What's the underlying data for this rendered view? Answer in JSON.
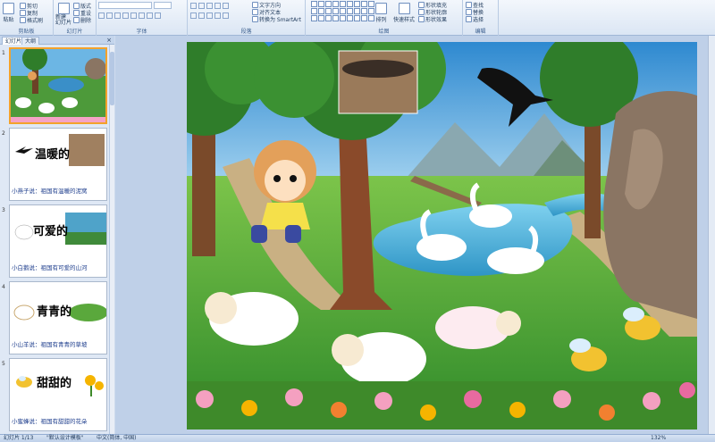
{
  "ribbon": {
    "clipboard": {
      "label": "剪贴板",
      "paste": "粘贴",
      "cut": "剪切",
      "copy": "复制",
      "format_painter": "格式刷"
    },
    "slides": {
      "label": "幻灯片",
      "new_slide": "新建\n幻灯片",
      "layout": "版式",
      "reset": "重设",
      "delete": "删除"
    },
    "font": {
      "label": "字体"
    },
    "paragraph": {
      "label": "段落",
      "text_direction": "文字方向",
      "align_text": "对齐文本",
      "smartart": "转换为 SmartArt"
    },
    "drawing": {
      "label": "绘图",
      "arrange": "排列",
      "quick_styles": "快速样式",
      "shape_fill": "形状填充",
      "shape_outline": "形状轮廓",
      "shape_effects": "形状效果"
    },
    "editing": {
      "label": "编辑",
      "find": "查找",
      "replace": "替换",
      "select": "选择"
    }
  },
  "left_panel": {
    "tabs": [
      "幻灯片",
      "大纲"
    ],
    "close": "×",
    "slides": [
      {
        "num": "1",
        "title": "",
        "caption": ""
      },
      {
        "num": "2",
        "title": "温暖的",
        "caption": "小燕子说：祖国有温暖的泥窝"
      },
      {
        "num": "3",
        "title": "可爱的",
        "caption": "小白鹅说：祖国有可爱的山河"
      },
      {
        "num": "4",
        "title": "青青的",
        "caption": "小山羊说：祖国有青青的草坡"
      },
      {
        "num": "5",
        "title": "甜甜的",
        "caption": "小蜜蜂说：祖国有甜甜的花朵"
      }
    ]
  },
  "statusbar": {
    "slide_info": "幻灯片 1/13",
    "theme": "\"默认设计模板\"",
    "language": "中文(简体, 中国)",
    "zoom": "132%"
  },
  "colors": {
    "accent": "#f3a22b",
    "ribbon_bg": "#dbe6f4",
    "caption": "#1c3c8c"
  }
}
